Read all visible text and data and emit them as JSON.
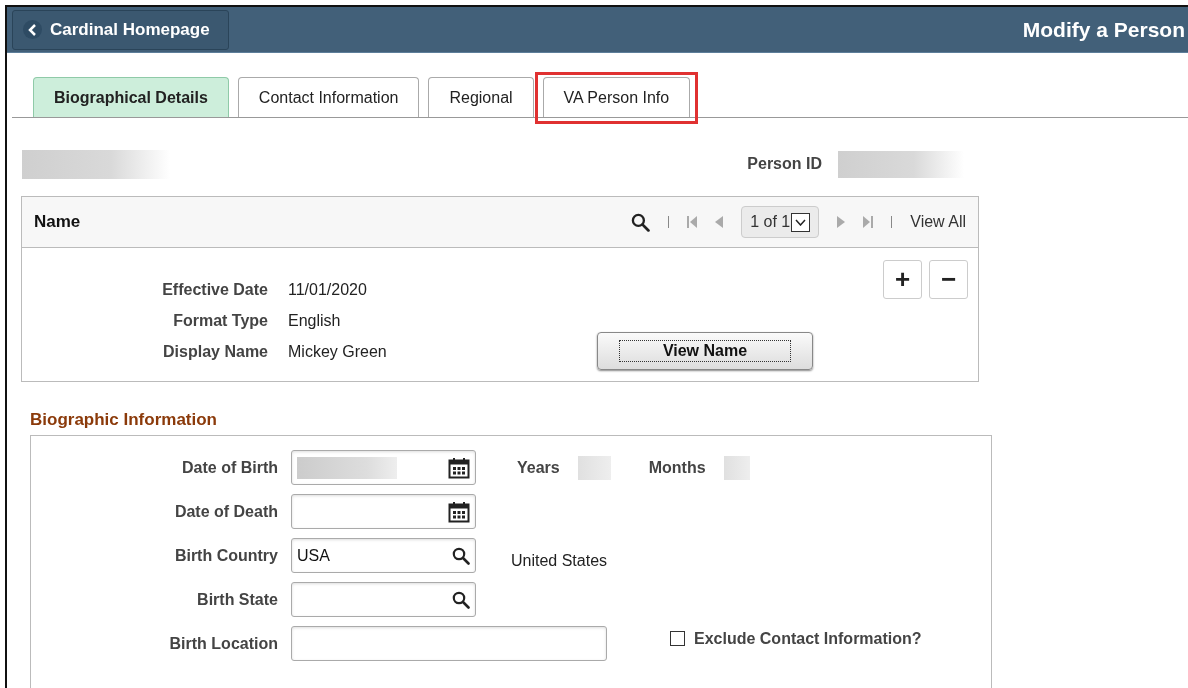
{
  "header": {
    "back_button": "Cardinal Homepage",
    "title": "Modify a Person"
  },
  "tabs": [
    {
      "label": "Biographical Details",
      "selected": true,
      "highlighted": false
    },
    {
      "label": "Contact Information",
      "selected": false,
      "highlighted": false
    },
    {
      "label": "Regional",
      "selected": false,
      "highlighted": false
    },
    {
      "label": "VA Person Info",
      "selected": false,
      "highlighted": true
    }
  ],
  "person_id": {
    "label": "Person ID"
  },
  "name_grid": {
    "title": "Name",
    "pager": "1 of 1",
    "view_all": "View All",
    "fields": [
      {
        "label": "Effective Date",
        "value": "11/01/2020"
      },
      {
        "label": "Format Type",
        "value": "English"
      },
      {
        "label": "Display Name",
        "value": "Mickey Green"
      }
    ],
    "add_button": "+",
    "remove_button": "−",
    "view_name_button": "View Name"
  },
  "biographic": {
    "title": "Biographic Information",
    "fields": [
      {
        "label": "Date of Birth",
        "kind": "date"
      },
      {
        "label": "Date of Death",
        "kind": "date"
      },
      {
        "label": "Birth Country",
        "kind": "lookup",
        "value": "USA",
        "description": "United States"
      },
      {
        "label": "Birth State",
        "kind": "lookup"
      },
      {
        "label": "Birth Location",
        "kind": "text"
      }
    ],
    "years_label": "Years",
    "months_label": "Months",
    "exclude_contact": {
      "label": "Exclude Contact Information?",
      "checked": false
    }
  }
}
